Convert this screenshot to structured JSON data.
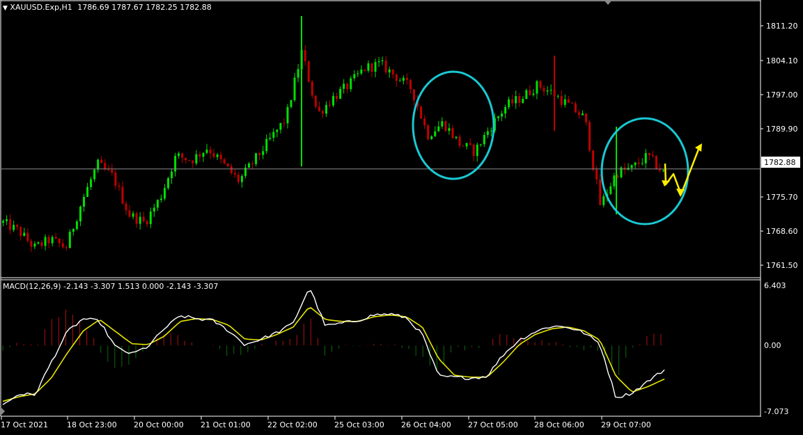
{
  "main_chart": {
    "symbol": "XAUUSD.Exp",
    "timeframe": "H1",
    "ohlc": "1786.69 1787.67 1782.25 1782.88",
    "current_price_label": "1782.88",
    "price_axis_labels": [
      "1811.20",
      "1804.10",
      "1797.00",
      "1789.90",
      "1782.88",
      "1775.70",
      "1768.60",
      "1761.50"
    ]
  },
  "macd_panel": {
    "label": "MACD(12,26,9) -2.143 -3.307 1.513 0.000 -2.143 -3.307",
    "axis_labels": [
      "6.403",
      "0.00",
      "-7.073"
    ]
  },
  "time_axis_labels": [
    "17 Oct 2021",
    "18 Oct 23:00",
    "20 Oct 00:00",
    "21 Oct 01:00",
    "22 Oct 02:00",
    "25 Oct 03:00",
    "26 Oct 04:00",
    "27 Oct 05:00",
    "28 Oct 06:00",
    "29 Oct 07:00"
  ],
  "colors": {
    "background": "#000000",
    "bull_candle": "#00e000",
    "bear_candle": "#c00000",
    "macd_line": "#ffffff",
    "signal_line": "#e6e600",
    "hist_positive": "#b01010",
    "hist_negative": "#0c6a0c",
    "annotation_circle": "#19c8d2",
    "annotation_arrow": "#ffee00",
    "grid_line": "#ffffff"
  },
  "chart_data": [
    {
      "type": "candlestick",
      "title": "XAUUSD.Exp,H1",
      "ylim": [
        1758,
        1821
      ],
      "x": [
        "17 Oct 2021",
        "18 Oct 23:00",
        "20 Oct 00:00",
        "21 Oct 01:00",
        "22 Oct 02:00",
        "25 Oct 03:00",
        "26 Oct 04:00",
        "27 Oct 05:00",
        "28 Oct 06:00",
        "29 Oct 07:00"
      ],
      "close_path": [
        1770,
        1768,
        1764,
        1766,
        1764,
        1775,
        1784,
        1781,
        1772,
        1770,
        1776,
        1786,
        1785,
        1788,
        1784,
        1780,
        1785,
        1790,
        1795,
        1811,
        1796,
        1800,
        1803,
        1807,
        1808,
        1805,
        1802,
        1791,
        1794,
        1789,
        1787,
        1793,
        1798,
        1800,
        1803,
        1801,
        1798,
        1795,
        1774,
        1782,
        1783,
        1786,
        1782
      ],
      "current_price": 1782.88,
      "annotations": [
        "circle 26 Oct",
        "circle 29 Oct",
        "yellow arrow down-up projection"
      ]
    },
    {
      "type": "line",
      "title": "MACD(12,26,9)",
      "ylim": [
        -7.073,
        6.403
      ],
      "series": [
        {
          "name": "MACD",
          "values": [
            -6.4,
            -5.2,
            -5.3,
            -1.8,
            1.5,
            2.9,
            2.6,
            -0.2,
            -0.9,
            -0.1,
            1.8,
            3.2,
            2.9,
            2.7,
            1.6,
            0.1,
            0.7,
            1.4,
            2.4,
            6.3,
            2.1,
            2.4,
            2.7,
            3.3,
            3.4,
            3.0,
            1.2,
            -3.3,
            -3.4,
            -3.5,
            -3.3,
            -1.0,
            0.6,
            1.5,
            2.1,
            2.0,
            1.4,
            0.2,
            -5.6,
            -5.1,
            -3.8,
            -2.6
          ]
        },
        {
          "name": "Signal",
          "values": [
            -6.0,
            -5.5,
            -5.2,
            -3.5,
            -0.8,
            1.6,
            2.8,
            1.5,
            0.2,
            0.1,
            1.0,
            2.6,
            2.9,
            2.8,
            2.2,
            0.7,
            0.6,
            1.2,
            2.0,
            4.2,
            2.8,
            2.6,
            2.6,
            3.1,
            3.3,
            3.1,
            2.0,
            -1.4,
            -3.2,
            -3.4,
            -3.4,
            -1.8,
            0.1,
            1.2,
            1.8,
            2.0,
            1.6,
            0.6,
            -3.3,
            -5.0,
            -4.4,
            -3.6
          ]
        }
      ]
    }
  ]
}
